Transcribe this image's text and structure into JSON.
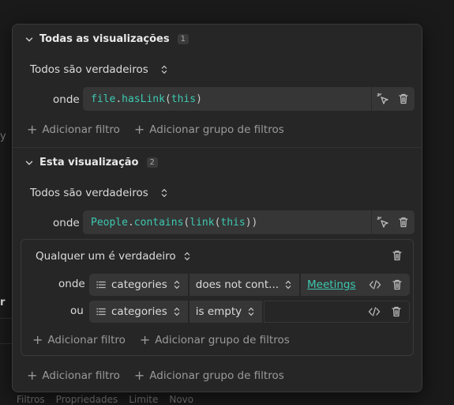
{
  "background": {
    "left_fragment_1": "y",
    "left_fragment_2": "r",
    "bottom_tabs": [
      "Filtros",
      "Propriedades",
      "Limite",
      "Novo"
    ]
  },
  "view_all": {
    "title": "Todas as visualizações",
    "count": "1",
    "conjunction": "Todos são verdadeiros",
    "where_label": "onde",
    "expression": {
      "object": "file",
      "dot": ".",
      "method": "hasLink",
      "open": "(",
      "arg": "this",
      "close": ")"
    },
    "add_filter": "Adicionar filtro",
    "add_group": "Adicionar grupo de filtros"
  },
  "this_view": {
    "title": "Esta visualização",
    "count": "2",
    "conjunction": "Todos são verdadeiros",
    "where_label": "onde",
    "expression": {
      "object": "People",
      "dot": ".",
      "method": "contains",
      "open": "(",
      "inner_fn": "link",
      "inner_open": "(",
      "arg": "this",
      "inner_close": ")",
      "close": ")"
    },
    "group": {
      "conjunction": "Qualquer um é verdadeiro",
      "rows": [
        {
          "label": "onde",
          "property": "categories",
          "operator": "does not cont...",
          "value": "Meetings"
        },
        {
          "label": "ou",
          "property": "categories",
          "operator": "is empty",
          "value": ""
        }
      ],
      "add_filter": "Adicionar filtro",
      "add_group": "Adicionar grupo de filtros"
    },
    "add_filter": "Adicionar filtro",
    "add_group": "Adicionar grupo de filtros"
  },
  "colors": {
    "accent": "#3cc9b0",
    "panel": "#262626",
    "field": "#363636"
  },
  "icons": [
    "chevron-down-icon",
    "updown-icon",
    "cursor-click-icon",
    "trash-icon",
    "plus-icon",
    "list-icon",
    "code-icon"
  ]
}
